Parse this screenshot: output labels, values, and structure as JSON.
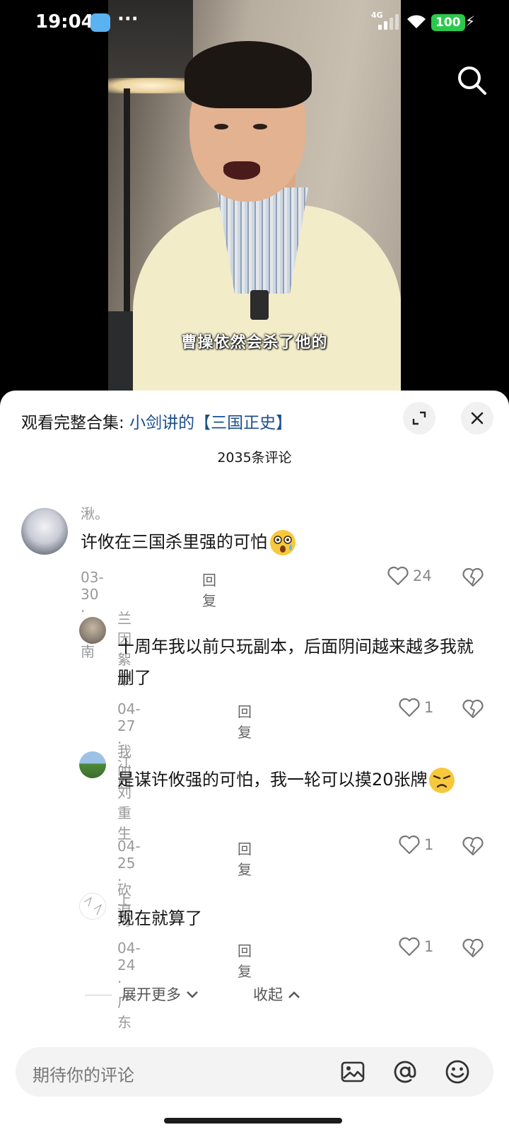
{
  "status_bar": {
    "time": "19:04",
    "dots": "···",
    "network": "4G",
    "battery": "100"
  },
  "video": {
    "subtitle": "曹操依然会杀了他的"
  },
  "sheet": {
    "collection_prefix": "观看完整合集: ",
    "collection_link": "小剑讲的【三国正史】",
    "comment_count": "2035条评论",
    "comments": [
      {
        "user": "湫。",
        "text": "许攸在三国杀里强的可怕",
        "date": "03-30",
        "location": "云南",
        "reply": "回复",
        "likes": "24",
        "emoji": "dizzy-face"
      },
      {
        "user": "兰因絮果",
        "text": "十周年我以前只玩副本，后面阴间越来越多我就删了",
        "date": "04-27",
        "location": "江西",
        "reply": "回复",
        "likes": "1"
      },
      {
        "user": "我叫刘重生",
        "text": "是谋许攸强的可怕，我一轮可以摸20张牌",
        "date": "04-25",
        "location": "上海",
        "reply": "回复",
        "likes": "1",
        "emoji": "unamused-face"
      },
      {
        "user": "砍浪",
        "text": "现在就算了",
        "date": "04-24",
        "location": "广东",
        "reply": "回复",
        "likes": "1"
      }
    ],
    "separator": " · ",
    "expand_more": "展开更多",
    "collapse": "收起",
    "input_placeholder": "期待你的评论"
  },
  "colors": {
    "link": "#1a4f8b",
    "battery": "#2cc84d",
    "muted": "#999999"
  }
}
